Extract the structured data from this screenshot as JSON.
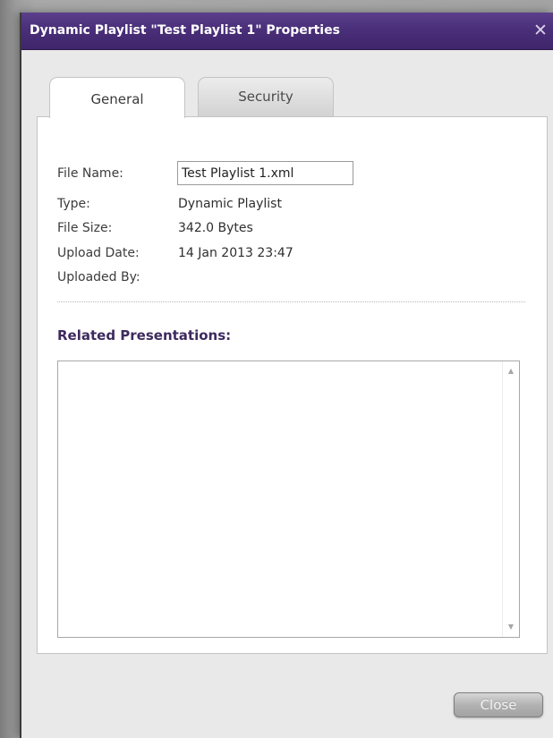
{
  "dialog": {
    "title": "Dynamic Playlist \"Test Playlist 1\" Properties",
    "close_icon": "close-icon"
  },
  "tabs": [
    {
      "label": "General",
      "active": true
    },
    {
      "label": "Security",
      "active": false
    }
  ],
  "general": {
    "file_name_label": "File Name:",
    "file_name_value": "Test Playlist 1.xml",
    "type_label": "Type:",
    "type_value": "Dynamic Playlist",
    "file_size_label": "File Size:",
    "file_size_value": "342.0 Bytes",
    "upload_date_label": "Upload Date:",
    "upload_date_value": "14 Jan 2013 23:47",
    "uploaded_by_label": "Uploaded By:",
    "uploaded_by_value": ""
  },
  "related": {
    "heading": "Related Presentations:",
    "items": [],
    "scroll_up_icon": "scroll-up-arrow-icon",
    "scroll_down_icon": "scroll-down-arrow-icon"
  },
  "footer": {
    "close_label": "Close"
  },
  "colors": {
    "titlebar": "#4a2f7a",
    "heading": "#3d2a5e"
  }
}
